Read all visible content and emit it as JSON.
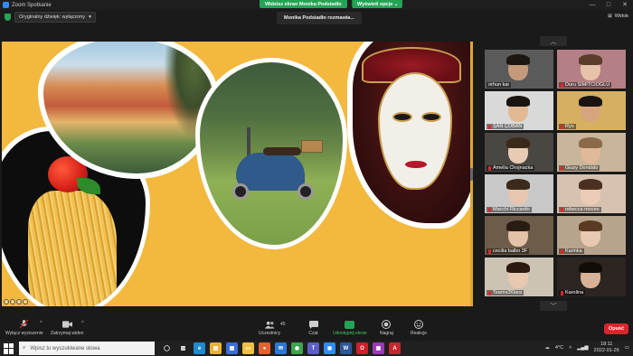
{
  "window": {
    "title": "Zoom Spotkanie",
    "controls": [
      "—",
      "□",
      "✕"
    ]
  },
  "share_banner": {
    "label": "Widzisz ekran Monika Podsiadło",
    "options_label": "Wyświetl opcje",
    "options_arrow": "⌄"
  },
  "top_bar": {
    "original_sound": "Oryginalny dźwięk: wyłączony",
    "original_sound_arrow": "▾",
    "speaking": "Monika Podsiadło rozmawia...",
    "view_label": "Widok",
    "view_icon": "⊞"
  },
  "panel": {
    "up_arrow": "︿",
    "down_arrow": "﹀",
    "participants": [
      {
        "name": "orhun kar",
        "muted": false,
        "bg": "#5a5a5a",
        "skin": "#c59a7a",
        "hair": "#1d1712"
      },
      {
        "name": "Duru SİMİTCİOĞLU",
        "muted": true,
        "bg": "#b57f86",
        "skin": "#e6c2a8",
        "hair": "#5a3e2b"
      },
      {
        "name": "ŞAN ÇOBAN",
        "muted": true,
        "bg": "#d9d9d9",
        "skin": "#e3b994",
        "hair": "#1a1410"
      },
      {
        "name": "Ryo",
        "muted": true,
        "bg": "#d6b060",
        "skin": "#d6a57e",
        "hair": "#1a1410"
      },
      {
        "name": "Amelia Chojnacka",
        "muted": true,
        "bg": "#4a4642",
        "skin": "#e8cbb4",
        "hair": "#3b2a1a"
      },
      {
        "name": "Giusy Dondato",
        "muted": true,
        "bg": "#c9b59a",
        "skin": "#e0b89a",
        "hair": "#8a6a4a"
      },
      {
        "name": "Macchi Riccardo",
        "muted": true,
        "bg": "#c8c8c8",
        "skin": "#e6c6ae",
        "hair": "#3a2a1c"
      },
      {
        "name": "rebecca moceo",
        "muted": true,
        "bg": "#d7c2b0",
        "skin": "#ebcbb6",
        "hair": "#4a3020"
      },
      {
        "name": "cecilia balbo 3F",
        "muted": true,
        "bg": "#6d5c4a",
        "skin": "#e3c2a8",
        "hair": "#2a1c12"
      },
      {
        "name": "Karinka",
        "muted": true,
        "bg": "#b7a48c",
        "skin": "#e8c9b2",
        "hair": "#5a3a22"
      },
      {
        "name": "Teamx2Klara",
        "muted": true,
        "bg": "#cdc3b4",
        "skin": "#e8c8b0",
        "hair": "#2a1a10"
      },
      {
        "name": "Karolina",
        "muted": true,
        "bg": "#2c2522",
        "skin": "#d8b296",
        "hair": "#120c08"
      }
    ]
  },
  "toolbar": {
    "mute_label": "Wyłącz wyciszenie",
    "video_label": "Zatrzymaj wideo",
    "participants_label": "Uczestnicy",
    "participants_count": "45",
    "chat_label": "Czat",
    "share_label": "Udostępnij ekran",
    "record_label": "Nagraj",
    "reactions_label": "Reakcje",
    "caret": "^",
    "end_label": "Opuść"
  },
  "taskbar": {
    "search_placeholder": "Wpisz tu wyszukiwane słowa",
    "search_icon": "⌕",
    "weather": "4°C",
    "tray_arrow": "˄",
    "time": "18:11",
    "date": "2022-01-26",
    "apps": [
      {
        "name": "task-view-icon",
        "glyph": "◯",
        "color": "#202020"
      },
      {
        "name": "widgets-icon",
        "glyph": "▥",
        "color": "#202020"
      },
      {
        "name": "edge-icon",
        "glyph": "e",
        "color": "#1f8ad2"
      },
      {
        "name": "files-icon",
        "glyph": "▤",
        "color": "#e8b23a"
      },
      {
        "name": "store-icon",
        "glyph": "▦",
        "color": "#3a6fd8"
      },
      {
        "name": "explorer-icon",
        "glyph": "▭",
        "color": "#f0c040"
      },
      {
        "name": "firefox-icon",
        "glyph": "●",
        "color": "#e8602c"
      },
      {
        "name": "mail-icon",
        "glyph": "✉",
        "color": "#2b78d8"
      },
      {
        "name": "chrome-icon",
        "glyph": "◉",
        "color": "#3fa34d"
      },
      {
        "name": "teams-icon",
        "glyph": "T",
        "color": "#5b5fc7"
      },
      {
        "name": "zoom-icon",
        "glyph": "◼",
        "color": "#2d8cff"
      },
      {
        "name": "word-icon",
        "glyph": "W",
        "color": "#2b579a"
      },
      {
        "name": "opera-icon",
        "glyph": "O",
        "color": "#d01e2a"
      },
      {
        "name": "photos-icon",
        "glyph": "▣",
        "color": "#9a3ab8"
      },
      {
        "name": "acrobat-icon",
        "glyph": "A",
        "color": "#c8262c"
      }
    ]
  },
  "colors": {
    "accent_green": "#23a455",
    "end_red": "#d9262b",
    "slide_bg": "#f3b83e"
  }
}
